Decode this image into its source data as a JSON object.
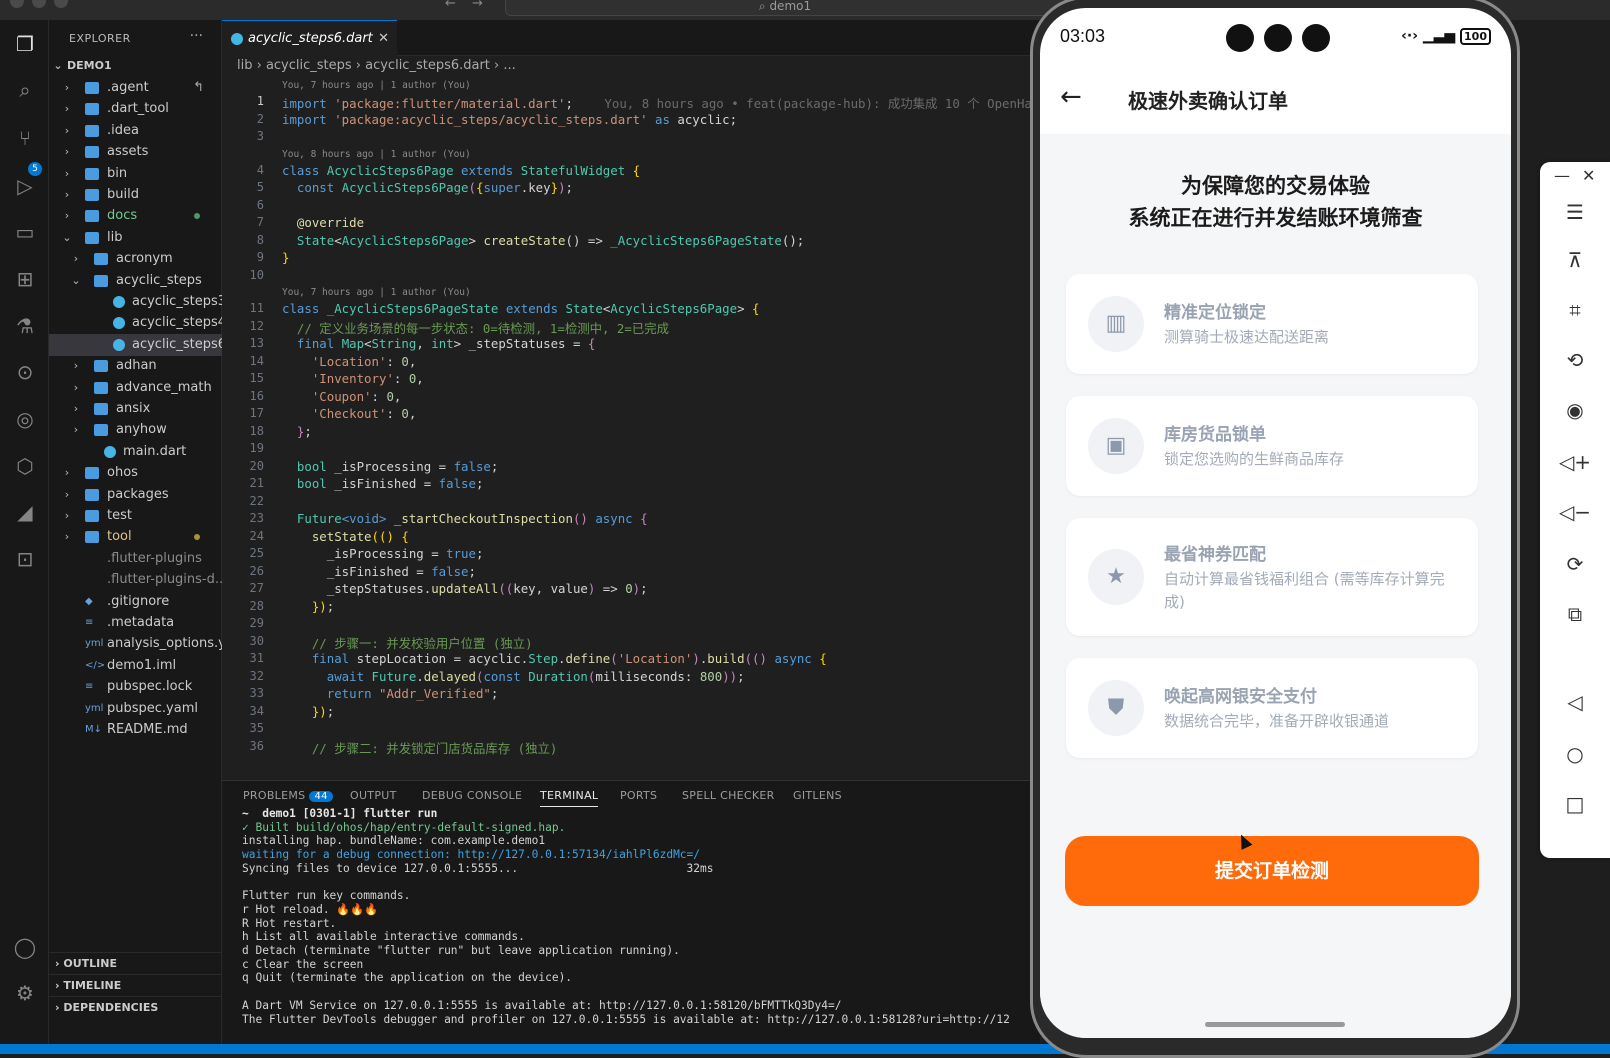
{
  "window": {
    "search": "demo1"
  },
  "activity": {
    "scm_badge": "5"
  },
  "explorer": {
    "header": "EXPLORER",
    "root": "DEMO1",
    "items": [
      {
        "label": "agent",
        "display": ".agent",
        "depth": 1,
        "kind": "folder",
        "open": false,
        "mark": "↰"
      },
      {
        "label": ".dart_tool",
        "depth": 1,
        "kind": "folder",
        "open": false
      },
      {
        "label": ".idea",
        "depth": 1,
        "kind": "folder",
        "open": false
      },
      {
        "label": "assets",
        "depth": 1,
        "kind": "folder",
        "open": false
      },
      {
        "label": "bin",
        "depth": 1,
        "kind": "folder",
        "open": false
      },
      {
        "label": "build",
        "depth": 1,
        "kind": "folder",
        "open": false
      },
      {
        "label": "docs",
        "depth": 1,
        "kind": "folder",
        "open": false,
        "color": "#73c991",
        "dot": "#4c9a6a"
      },
      {
        "label": "lib",
        "depth": 1,
        "kind": "folder",
        "open": true
      },
      {
        "label": "acronym",
        "depth": 2,
        "kind": "folder",
        "open": false
      },
      {
        "label": "acyclic_steps",
        "depth": 2,
        "kind": "folder",
        "open": true
      },
      {
        "label": "acyclic_steps3....",
        "depth": 3,
        "kind": "dart"
      },
      {
        "label": "acyclic_steps4....",
        "depth": 3,
        "kind": "dart"
      },
      {
        "label": "acyclic_steps6....",
        "depth": 3,
        "kind": "dart",
        "selected": true
      },
      {
        "label": "adhan",
        "depth": 2,
        "kind": "folder",
        "open": false
      },
      {
        "label": "advance_math",
        "depth": 2,
        "kind": "folder",
        "open": false
      },
      {
        "label": "ansix",
        "depth": 2,
        "kind": "folder",
        "open": false
      },
      {
        "label": "anyhow",
        "depth": 2,
        "kind": "folder",
        "open": false
      },
      {
        "label": "main.dart",
        "depth": 2,
        "kind": "dart"
      },
      {
        "label": "ohos",
        "depth": 1,
        "kind": "folder",
        "open": false
      },
      {
        "label": "packages",
        "depth": 1,
        "kind": "folder",
        "open": false
      },
      {
        "label": "test",
        "depth": 1,
        "kind": "folder",
        "open": false
      },
      {
        "label": "tool",
        "depth": 1,
        "kind": "folder",
        "open": false,
        "color": "#e2c08d",
        "dot": "#a8923c"
      },
      {
        "label": ".flutter-plugins",
        "depth": 1,
        "kind": "file",
        "color": "#8b8b8b"
      },
      {
        "label": ".flutter-plugins-d...",
        "depth": 1,
        "kind": "file",
        "color": "#8b8b8b"
      },
      {
        "label": ".gitignore",
        "depth": 1,
        "kind": "file",
        "icon": "◆"
      },
      {
        "label": ".metadata",
        "depth": 1,
        "kind": "file",
        "icon": "≡"
      },
      {
        "label": "analysis_options.y...",
        "depth": 1,
        "kind": "file",
        "icon": "yml"
      },
      {
        "label": "demo1.iml",
        "depth": 1,
        "kind": "file",
        "icon": "</>"
      },
      {
        "label": "pubspec.lock",
        "depth": 1,
        "kind": "file",
        "icon": "≡"
      },
      {
        "label": "pubspec.yaml",
        "depth": 1,
        "kind": "file",
        "icon": "yml"
      },
      {
        "label": "README.md",
        "depth": 1,
        "kind": "file",
        "icon": "M↓"
      }
    ],
    "footer": [
      "OUTLINE",
      "TIMELINE",
      "DEPENDENCIES"
    ]
  },
  "editor": {
    "tab": "acyclic_steps6.dart",
    "breadcrumb": "lib  ›  acyclic_steps  ›    acyclic_steps6.dart  ›  ...",
    "blames": [
      {
        "before": 1,
        "text": "You, 7 hours ago | 1 author (You)"
      },
      {
        "before": 4,
        "text": "You, 8 hours ago | 1 author (You)"
      },
      {
        "before": 11,
        "text": "You, 7 hours ago | 1 author (You)"
      }
    ],
    "inline_blame": "You, 8 hours ago • feat(package-hub): 成功集成 10 个 OpenHa",
    "lines": [
      [
        [
          "kw",
          "import "
        ],
        [
          "st",
          "'package:flutter/material.dart'"
        ],
        [
          "",
          "; "
        ]
      ],
      [
        [
          "kw",
          "import "
        ],
        [
          "st",
          "'package:acyclic_steps/acyclic_steps.dart'"
        ],
        [
          "kw",
          " as "
        ],
        [
          "",
          "acyclic;"
        ]
      ],
      [],
      [
        [
          "kw",
          "class "
        ],
        [
          "ty",
          "AcyclicSteps6Page "
        ],
        [
          "kw",
          "extends "
        ],
        [
          "ty",
          "StatefulWidget "
        ],
        [
          "br",
          "{"
        ]
      ],
      [
        [
          "",
          "  "
        ],
        [
          "kw",
          "const "
        ],
        [
          "ty",
          "AcyclicSteps6Page"
        ],
        [
          "pk",
          "("
        ],
        [
          "br",
          "{"
        ],
        [
          "kw",
          "super"
        ],
        [
          "",
          ".key"
        ],
        [
          "br",
          "}"
        ],
        [
          "pk",
          ")"
        ],
        [
          "",
          ";"
        ]
      ],
      [],
      [
        [
          "",
          "  "
        ],
        [
          "fn",
          "@override"
        ]
      ],
      [
        [
          "",
          "  "
        ],
        [
          "ty",
          "State"
        ],
        [
          "",
          "<"
        ],
        [
          "ty",
          "AcyclicSteps6Page"
        ],
        [
          "",
          "> "
        ],
        [
          "fn",
          "createState"
        ],
        [
          "",
          "() => "
        ],
        [
          "ty",
          "_AcyclicSteps6PageState"
        ],
        [
          "",
          "();"
        ]
      ],
      [
        [
          "br",
          "}"
        ]
      ],
      [],
      [
        [
          "kw",
          "class "
        ],
        [
          "ty",
          "_AcyclicSteps6PageState "
        ],
        [
          "kw",
          "extends "
        ],
        [
          "ty",
          "State"
        ],
        [
          "",
          "<"
        ],
        [
          "ty",
          "AcyclicSteps6Page"
        ],
        [
          "",
          "> "
        ],
        [
          "br",
          "{"
        ]
      ],
      [
        [
          "cm",
          "  // 定义业务场景的每一步状态: 0=待检测, 1=检测中, 2=已完成"
        ]
      ],
      [
        [
          "",
          "  "
        ],
        [
          "kw",
          "final "
        ],
        [
          "ty",
          "Map"
        ],
        [
          "",
          "<"
        ],
        [
          "ty",
          "String"
        ],
        [
          "",
          ", "
        ],
        [
          "ty",
          "int"
        ],
        [
          "",
          "> _stepStatuses = "
        ],
        [
          "pk",
          "{"
        ]
      ],
      [
        [
          "",
          "    "
        ],
        [
          "st",
          "'Location'"
        ],
        [
          "",
          ": "
        ],
        [
          "nm",
          "0"
        ],
        [
          "",
          ","
        ]
      ],
      [
        [
          "",
          "    "
        ],
        [
          "st",
          "'Inventory'"
        ],
        [
          "",
          ": "
        ],
        [
          "nm",
          "0"
        ],
        [
          "",
          ","
        ]
      ],
      [
        [
          "",
          "    "
        ],
        [
          "st",
          "'Coupon'"
        ],
        [
          "",
          ": "
        ],
        [
          "nm",
          "0"
        ],
        [
          "",
          ","
        ]
      ],
      [
        [
          "",
          "    "
        ],
        [
          "st",
          "'Checkout'"
        ],
        [
          "",
          ": "
        ],
        [
          "nm",
          "0"
        ],
        [
          "",
          ","
        ]
      ],
      [
        [
          "",
          "  "
        ],
        [
          "pk",
          "}"
        ],
        [
          "",
          ";"
        ]
      ],
      [],
      [
        [
          "",
          "  "
        ],
        [
          "ty",
          "bool "
        ],
        [
          "",
          "_isProcessing = "
        ],
        [
          "kw",
          "false"
        ],
        [
          "",
          ";"
        ]
      ],
      [
        [
          "",
          "  "
        ],
        [
          "ty",
          "bool "
        ],
        [
          "",
          "_isFinished = "
        ],
        [
          "kw",
          "false"
        ],
        [
          "",
          ";"
        ]
      ],
      [],
      [
        [
          "",
          "  "
        ],
        [
          "ty",
          "Future"
        ],
        [
          "kw",
          "<void>"
        ],
        [
          "",
          ""
        ],
        [
          "fn",
          " _startCheckoutInspection"
        ],
        [
          "pk",
          "()"
        ],
        [
          "kw",
          " async "
        ],
        [
          "pk",
          "{"
        ]
      ],
      [
        [
          "",
          "    "
        ],
        [
          "fn",
          "setState"
        ],
        [
          "br",
          "(() {"
        ]
      ],
      [
        [
          "",
          "      _isProcessing = "
        ],
        [
          "kw",
          "true"
        ],
        [
          "",
          ";"
        ]
      ],
      [
        [
          "",
          "      _isFinished = "
        ],
        [
          "kw",
          "false"
        ],
        [
          "",
          ";"
        ]
      ],
      [
        [
          "",
          "      _stepStatuses."
        ],
        [
          "fn",
          "updateAll"
        ],
        [
          "pk",
          "(("
        ],
        [
          "",
          "key, value"
        ],
        [
          "pk",
          ")"
        ],
        [
          "",
          " => "
        ],
        [
          "nm",
          "0"
        ],
        [
          "pk",
          ")"
        ],
        [
          "",
          ";"
        ]
      ],
      [
        [
          "",
          "    "
        ],
        [
          "br",
          "})"
        ],
        [
          "",
          ";"
        ]
      ],
      [],
      [
        [
          "cm",
          "    // 步骤一: 并发校验用户位置 (独立)"
        ]
      ],
      [
        [
          "",
          "    "
        ],
        [
          "kw",
          "final "
        ],
        [
          "",
          "stepLocation = acyclic."
        ],
        [
          "ty",
          "Step"
        ],
        [
          "",
          "."
        ],
        [
          "fn",
          "define"
        ],
        [
          "pk",
          "("
        ],
        [
          "st",
          "'Location'"
        ],
        [
          "pk",
          ")"
        ],
        [
          "",
          "."
        ],
        [
          "fn",
          "build"
        ],
        [
          "pk",
          "(("
        ],
        [
          "pk",
          ")"
        ],
        [
          "kw",
          " async "
        ],
        [
          "br",
          "{"
        ]
      ],
      [
        [
          "",
          "      "
        ],
        [
          "kw",
          "await "
        ],
        [
          "ty",
          "Future"
        ],
        [
          "",
          "."
        ],
        [
          "fn",
          "delayed"
        ],
        [
          "pk",
          "("
        ],
        [
          "kw",
          "const "
        ],
        [
          "ty",
          "Duration"
        ],
        [
          "pk",
          "("
        ],
        [
          "",
          "milliseconds: "
        ],
        [
          "nm",
          "800"
        ],
        [
          "pk",
          "))"
        ],
        [
          "",
          ";"
        ]
      ],
      [
        [
          "",
          "      "
        ],
        [
          "kw",
          "return "
        ],
        [
          "st",
          "\"Addr_Verified\""
        ],
        [
          "",
          ";"
        ]
      ],
      [
        [
          "",
          "    "
        ],
        [
          "br",
          "})"
        ],
        [
          "",
          ";"
        ]
      ],
      [],
      [
        [
          "cm",
          "    // 步骤二: 并发锁定门店货品库存 (独立)"
        ]
      ]
    ]
  },
  "panel": {
    "tabs": [
      "PROBLEMS",
      "OUTPUT",
      "DEBUG CONSOLE",
      "TERMINAL",
      "PORTS",
      "SPELL CHECKER",
      "GITLENS"
    ],
    "problems_count": "44",
    "active": "TERMINAL",
    "terminal": [
      {
        "t": "~  demo1 [0301-1] flutter run",
        "c": "#e6e6e6",
        "b": true
      },
      {
        "t": "✓ Built build/ohos/hap/entry-default-signed.hap.",
        "c": "#73c991"
      },
      {
        "t": "installing hap. bundleName: com.example.demo1",
        "c": "#d4d4d4"
      },
      {
        "t": "waiting for a debug connection: http://127.0.0.1:57134/iahlPl6zdMc=/",
        "c": "#3ea3e0"
      },
      {
        "t": "Syncing files to device 127.0.0.1:5555...                         32ms",
        "c": "#d4d4d4"
      },
      {
        "t": "",
        "c": "#d4d4d4"
      },
      {
        "t": "Flutter run key commands.",
        "c": "#d4d4d4"
      },
      {
        "t": "r Hot reload. 🔥🔥🔥",
        "c": "#d4d4d4"
      },
      {
        "t": "R Hot restart.",
        "c": "#d4d4d4"
      },
      {
        "t": "h List all available interactive commands.",
        "c": "#d4d4d4"
      },
      {
        "t": "d Detach (terminate \"flutter run\" but leave application running).",
        "c": "#d4d4d4"
      },
      {
        "t": "c Clear the screen",
        "c": "#d4d4d4"
      },
      {
        "t": "q Quit (terminate the application on the device).",
        "c": "#d4d4d4"
      },
      {
        "t": "",
        "c": "#d4d4d4"
      },
      {
        "t": "A Dart VM Service on 127.0.0.1:5555 is available at: http://127.0.0.1:58120/bFMTTkQ3Dy4=/",
        "c": "#d4d4d4"
      },
      {
        "t": "The Flutter DevTools debugger and profiler on 127.0.0.1:5555 is available at: http://127.0.0.1:58128?uri=http://12",
        "c": "#d4d4d4"
      }
    ]
  },
  "phone": {
    "time": "03:03",
    "battery": "100",
    "title": "极速外卖确认订单",
    "hero_line1": "为保障您的交易体验",
    "hero_line2": "系统正在进行并发结账环境筛查",
    "cards": [
      {
        "title": "精准定位锁定",
        "subtitle": "测算骑士极速达配送距离",
        "icon": "map-icon",
        "glyph": "▥"
      },
      {
        "title": "库房货品锁单",
        "subtitle": "锁定您选购的生鲜商品库存",
        "icon": "bag-icon",
        "glyph": "▣"
      },
      {
        "title": "最省神券匹配",
        "subtitle": "自动计算最省钱福利组合 (需等库存计算完成)",
        "icon": "ticket-icon",
        "glyph": "★"
      },
      {
        "title": "唤起高网银安全支付",
        "subtitle": "数据统合完毕，准备开辟收银通道",
        "icon": "shield-icon",
        "glyph": "⛊"
      }
    ],
    "submit": "提交订单检测"
  }
}
